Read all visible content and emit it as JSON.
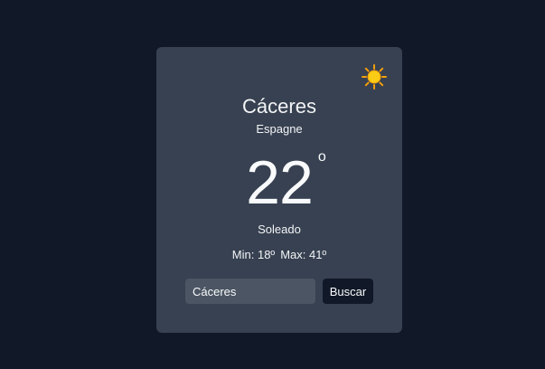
{
  "weather": {
    "city": "Cáceres",
    "country": "Espagne",
    "temperature": "22",
    "degree_symbol": "o",
    "condition": "Soleado",
    "min_label": "Min: 18º",
    "max_label": "Max: 41º",
    "icon": "sun-icon"
  },
  "search": {
    "value": "Cáceres",
    "button_label": "Buscar"
  },
  "colors": {
    "background": "#111827",
    "card": "#374151",
    "input": "#4b5563",
    "button": "#111827",
    "sun": "#facc15"
  }
}
